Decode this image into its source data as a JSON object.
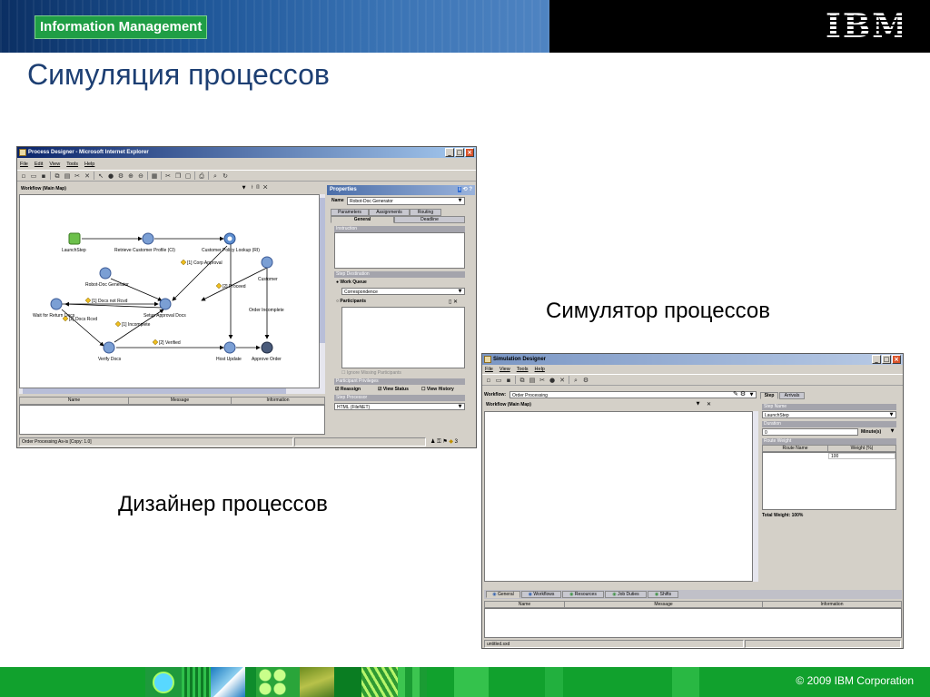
{
  "header": {
    "brand": "Information Management",
    "ibm_logo": "IBM"
  },
  "slide": {
    "title": "Симуляция процессов",
    "caption_simulator": "Симулятор процессов",
    "caption_designer": "Дизайнер процессов"
  },
  "footer": {
    "copyright": "© 2009  IBM Corporation"
  },
  "designer": {
    "title": "Process Designer - Microsoft Internet Explorer",
    "menu": [
      "File",
      "Edit",
      "View",
      "Tools",
      "Help"
    ],
    "workflow_select": "Workflow (Main Map)",
    "steps": {
      "launch": "LaunchStep",
      "retrieve": "Retrieve Customer Profile (CI)",
      "lookup": "Customer Policy Lookup (RI)",
      "robot": "Robot-Doc Generator",
      "customer": "Customer",
      "order_incomplete": "Order Incomplete",
      "wait": "Wait for Return Docs",
      "setup": "Setup Approval Docs",
      "verify": "Verify Docs",
      "host": "Host Update",
      "approve": "Approve Order"
    },
    "conditions": {
      "corp_approval": "[1] Corp Approval",
      "proceed": "[2] Proceed",
      "docs_not_rcvd": "[1] Docs not Rcvd",
      "docs_rcvd": "[2] Docs Rcvd",
      "incomplete": "[1] Incomplete",
      "verified": "[2] Verified"
    },
    "grid_columns": [
      "Name",
      "Message",
      "Information"
    ],
    "status_text": "Order Processing As-is [Copy: 1.0]",
    "status_counter": "3",
    "properties": {
      "header": "Properties",
      "name_label": "Name",
      "name_value": "Robot-Doc Generator",
      "tabs_top": [
        "Parameters",
        "Assignments",
        "Routing"
      ],
      "tabs_bottom": [
        "General",
        "Deadline"
      ],
      "instruction_label": "Instruction",
      "step_destination_label": "Step Destination",
      "work_queue_label": "Work Queue",
      "work_queue_value": "Correspondence",
      "participants_label": "Participants",
      "ignore_missing": "Ignore Missing Participants",
      "participant_privileges": "Participant Privileges",
      "reassign": "Reassign",
      "view_status": "View Status",
      "view_history": "View History",
      "step_processor_label": "Step Processor",
      "step_processor_value": "HTML (FileNET)"
    }
  },
  "simulator": {
    "title": "Simulation Designer",
    "menu": [
      "File",
      "View",
      "Tools",
      "Help"
    ],
    "workflow_label": "Workflow:",
    "workflow_value": "Order Processing",
    "map_select": "Workflow (Main Map)",
    "tabs_right": [
      "Step",
      "Arrivals"
    ],
    "step_name_label": "Step Name",
    "step_name_value": "LaunchStep",
    "duration_label": "Duration",
    "duration_value": "0",
    "duration_unit": "Minute(s)",
    "route_weight_label": "Route Weight",
    "route_columns": [
      "Route Name",
      "Weight (%)"
    ],
    "route_weight_value": "100",
    "total_weight": "Total Weight: 100%",
    "bottom_tabs": [
      "General",
      "Workflows",
      "Resources",
      "Job Duties",
      "Shifts"
    ],
    "grid_columns": [
      "Name",
      "Message",
      "Information"
    ],
    "status_text": "untitled.sxd"
  }
}
